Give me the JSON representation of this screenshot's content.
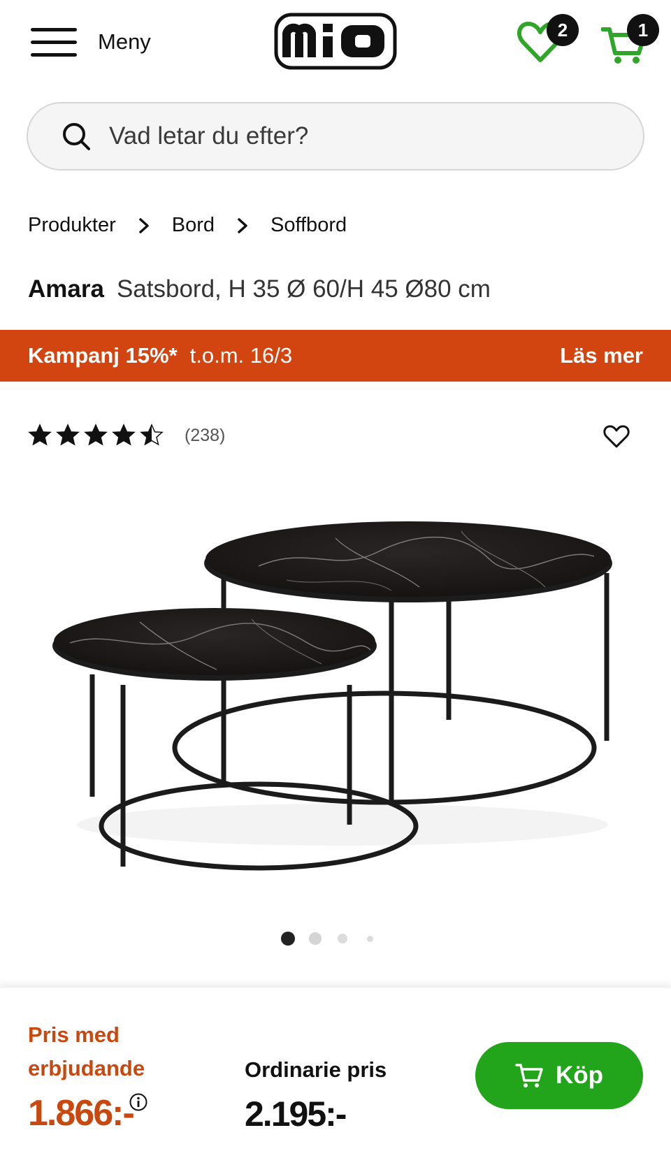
{
  "header": {
    "menu_label": "Meny",
    "logo_text": "MiO",
    "wishlist_count": "2",
    "cart_count": "1"
  },
  "search": {
    "placeholder": "Vad letar du efter?"
  },
  "breadcrumb": {
    "items": [
      "Produkter",
      "Bord",
      "Soffbord"
    ]
  },
  "product": {
    "brand": "Amara",
    "description": "Satsbord, H 35 Ø 60/H 45 Ø80 cm",
    "rating": 4.5,
    "rating_max": 5,
    "review_count": "(238)",
    "image_count": 4,
    "active_image": 1
  },
  "promo": {
    "label": "Kampanj 15%*",
    "date": "t.o.m. 16/3",
    "read_more": "Läs mer"
  },
  "pricing": {
    "offer_label": "Pris med erbjudande",
    "offer_price": "1.866:-",
    "regular_label": "Ordinarie pris",
    "regular_price": "2.195:-",
    "buy_label": "Köp"
  },
  "colors": {
    "promo_bg": "#d24510",
    "offer_text": "#c8490f",
    "buy_bg": "#23a51b",
    "icon_green": "#2fa52a"
  }
}
